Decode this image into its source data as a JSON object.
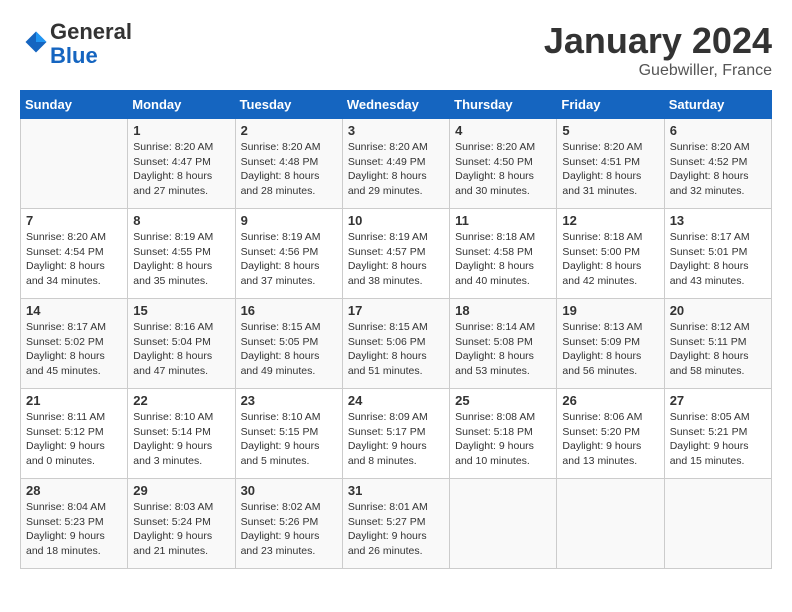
{
  "header": {
    "logo_general": "General",
    "logo_blue": "Blue",
    "title": "January 2024",
    "subtitle": "Guebwiller, France"
  },
  "weekdays": [
    "Sunday",
    "Monday",
    "Tuesday",
    "Wednesday",
    "Thursday",
    "Friday",
    "Saturday"
  ],
  "weeks": [
    [
      {
        "day": "",
        "sunrise": "",
        "sunset": "",
        "daylight": ""
      },
      {
        "day": "1",
        "sunrise": "Sunrise: 8:20 AM",
        "sunset": "Sunset: 4:47 PM",
        "daylight": "Daylight: 8 hours and 27 minutes."
      },
      {
        "day": "2",
        "sunrise": "Sunrise: 8:20 AM",
        "sunset": "Sunset: 4:48 PM",
        "daylight": "Daylight: 8 hours and 28 minutes."
      },
      {
        "day": "3",
        "sunrise": "Sunrise: 8:20 AM",
        "sunset": "Sunset: 4:49 PM",
        "daylight": "Daylight: 8 hours and 29 minutes."
      },
      {
        "day": "4",
        "sunrise": "Sunrise: 8:20 AM",
        "sunset": "Sunset: 4:50 PM",
        "daylight": "Daylight: 8 hours and 30 minutes."
      },
      {
        "day": "5",
        "sunrise": "Sunrise: 8:20 AM",
        "sunset": "Sunset: 4:51 PM",
        "daylight": "Daylight: 8 hours and 31 minutes."
      },
      {
        "day": "6",
        "sunrise": "Sunrise: 8:20 AM",
        "sunset": "Sunset: 4:52 PM",
        "daylight": "Daylight: 8 hours and 32 minutes."
      }
    ],
    [
      {
        "day": "7",
        "sunrise": "Sunrise: 8:20 AM",
        "sunset": "Sunset: 4:54 PM",
        "daylight": "Daylight: 8 hours and 34 minutes."
      },
      {
        "day": "8",
        "sunrise": "Sunrise: 8:19 AM",
        "sunset": "Sunset: 4:55 PM",
        "daylight": "Daylight: 8 hours and 35 minutes."
      },
      {
        "day": "9",
        "sunrise": "Sunrise: 8:19 AM",
        "sunset": "Sunset: 4:56 PM",
        "daylight": "Daylight: 8 hours and 37 minutes."
      },
      {
        "day": "10",
        "sunrise": "Sunrise: 8:19 AM",
        "sunset": "Sunset: 4:57 PM",
        "daylight": "Daylight: 8 hours and 38 minutes."
      },
      {
        "day": "11",
        "sunrise": "Sunrise: 8:18 AM",
        "sunset": "Sunset: 4:58 PM",
        "daylight": "Daylight: 8 hours and 40 minutes."
      },
      {
        "day": "12",
        "sunrise": "Sunrise: 8:18 AM",
        "sunset": "Sunset: 5:00 PM",
        "daylight": "Daylight: 8 hours and 42 minutes."
      },
      {
        "day": "13",
        "sunrise": "Sunrise: 8:17 AM",
        "sunset": "Sunset: 5:01 PM",
        "daylight": "Daylight: 8 hours and 43 minutes."
      }
    ],
    [
      {
        "day": "14",
        "sunrise": "Sunrise: 8:17 AM",
        "sunset": "Sunset: 5:02 PM",
        "daylight": "Daylight: 8 hours and 45 minutes."
      },
      {
        "day": "15",
        "sunrise": "Sunrise: 8:16 AM",
        "sunset": "Sunset: 5:04 PM",
        "daylight": "Daylight: 8 hours and 47 minutes."
      },
      {
        "day": "16",
        "sunrise": "Sunrise: 8:15 AM",
        "sunset": "Sunset: 5:05 PM",
        "daylight": "Daylight: 8 hours and 49 minutes."
      },
      {
        "day": "17",
        "sunrise": "Sunrise: 8:15 AM",
        "sunset": "Sunset: 5:06 PM",
        "daylight": "Daylight: 8 hours and 51 minutes."
      },
      {
        "day": "18",
        "sunrise": "Sunrise: 8:14 AM",
        "sunset": "Sunset: 5:08 PM",
        "daylight": "Daylight: 8 hours and 53 minutes."
      },
      {
        "day": "19",
        "sunrise": "Sunrise: 8:13 AM",
        "sunset": "Sunset: 5:09 PM",
        "daylight": "Daylight: 8 hours and 56 minutes."
      },
      {
        "day": "20",
        "sunrise": "Sunrise: 8:12 AM",
        "sunset": "Sunset: 5:11 PM",
        "daylight": "Daylight: 8 hours and 58 minutes."
      }
    ],
    [
      {
        "day": "21",
        "sunrise": "Sunrise: 8:11 AM",
        "sunset": "Sunset: 5:12 PM",
        "daylight": "Daylight: 9 hours and 0 minutes."
      },
      {
        "day": "22",
        "sunrise": "Sunrise: 8:10 AM",
        "sunset": "Sunset: 5:14 PM",
        "daylight": "Daylight: 9 hours and 3 minutes."
      },
      {
        "day": "23",
        "sunrise": "Sunrise: 8:10 AM",
        "sunset": "Sunset: 5:15 PM",
        "daylight": "Daylight: 9 hours and 5 minutes."
      },
      {
        "day": "24",
        "sunrise": "Sunrise: 8:09 AM",
        "sunset": "Sunset: 5:17 PM",
        "daylight": "Daylight: 9 hours and 8 minutes."
      },
      {
        "day": "25",
        "sunrise": "Sunrise: 8:08 AM",
        "sunset": "Sunset: 5:18 PM",
        "daylight": "Daylight: 9 hours and 10 minutes."
      },
      {
        "day": "26",
        "sunrise": "Sunrise: 8:06 AM",
        "sunset": "Sunset: 5:20 PM",
        "daylight": "Daylight: 9 hours and 13 minutes."
      },
      {
        "day": "27",
        "sunrise": "Sunrise: 8:05 AM",
        "sunset": "Sunset: 5:21 PM",
        "daylight": "Daylight: 9 hours and 15 minutes."
      }
    ],
    [
      {
        "day": "28",
        "sunrise": "Sunrise: 8:04 AM",
        "sunset": "Sunset: 5:23 PM",
        "daylight": "Daylight: 9 hours and 18 minutes."
      },
      {
        "day": "29",
        "sunrise": "Sunrise: 8:03 AM",
        "sunset": "Sunset: 5:24 PM",
        "daylight": "Daylight: 9 hours and 21 minutes."
      },
      {
        "day": "30",
        "sunrise": "Sunrise: 8:02 AM",
        "sunset": "Sunset: 5:26 PM",
        "daylight": "Daylight: 9 hours and 23 minutes."
      },
      {
        "day": "31",
        "sunrise": "Sunrise: 8:01 AM",
        "sunset": "Sunset: 5:27 PM",
        "daylight": "Daylight: 9 hours and 26 minutes."
      },
      {
        "day": "",
        "sunrise": "",
        "sunset": "",
        "daylight": ""
      },
      {
        "day": "",
        "sunrise": "",
        "sunset": "",
        "daylight": ""
      },
      {
        "day": "",
        "sunrise": "",
        "sunset": "",
        "daylight": ""
      }
    ]
  ]
}
